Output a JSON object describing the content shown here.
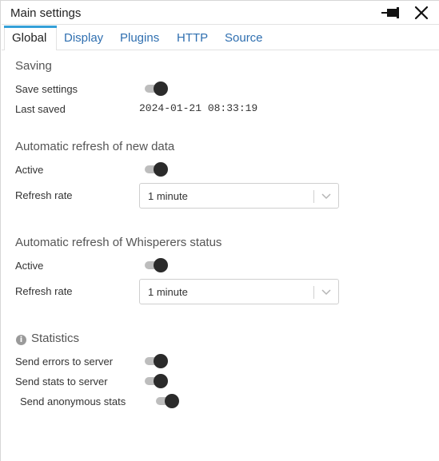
{
  "window": {
    "title": "Main settings"
  },
  "tabs": [
    {
      "label": "Global",
      "active": true
    },
    {
      "label": "Display",
      "active": false
    },
    {
      "label": "Plugins",
      "active": false
    },
    {
      "label": "HTTP",
      "active": false
    },
    {
      "label": "Source",
      "active": false
    }
  ],
  "saving": {
    "heading": "Saving",
    "save_settings_label": "Save settings",
    "save_settings_on": true,
    "last_saved_label": "Last saved",
    "last_saved_value": "2024-01-21 08:33:19"
  },
  "auto_refresh_data": {
    "heading": "Automatic refresh of new data",
    "active_label": "Active",
    "active_on": true,
    "rate_label": "Refresh rate",
    "rate_value": "1 minute"
  },
  "auto_refresh_whisperers": {
    "heading": "Automatic refresh of Whisperers status",
    "active_label": "Active",
    "active_on": true,
    "rate_label": "Refresh rate",
    "rate_value": "1 minute"
  },
  "statistics": {
    "heading": "Statistics",
    "info_icon": "i",
    "send_errors_label": "Send errors to server",
    "send_errors_on": true,
    "send_stats_label": "Send stats to server",
    "send_stats_on": true,
    "send_anonymous_label": "Send anonymous stats",
    "send_anonymous_on": true
  },
  "icons": {
    "pin": "pin-icon",
    "close": "close-icon",
    "chevron": "chevron-down-icon",
    "info": "info-icon"
  },
  "colors": {
    "accent": "#34a0d8",
    "tab_link": "#2f6fb0",
    "toggle_knob": "#2b2b2b",
    "toggle_track": "#bdbdbd"
  }
}
